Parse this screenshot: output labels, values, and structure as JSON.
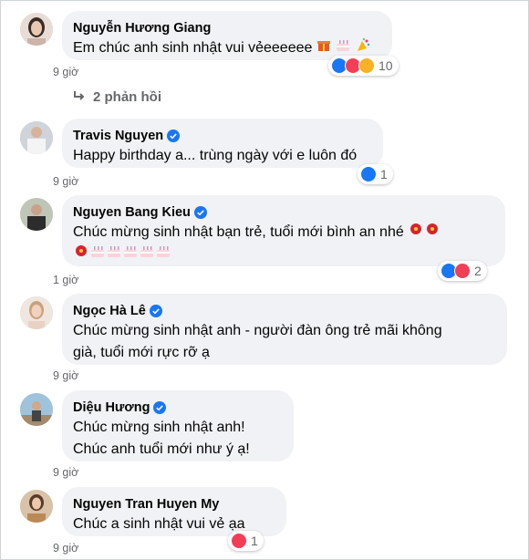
{
  "comments": [
    {
      "author": "Nguyễn Hương Giang",
      "text": "Em chúc anh sinh nhật vui vẻeeeeee",
      "time": "9 giờ",
      "reactions": {
        "icons": [
          "like-icon",
          "love-icon",
          "care-icon"
        ],
        "count": "10"
      },
      "verified": false
    },
    {
      "author": "Travis Nguyen",
      "text": "Happy birthday a... trùng ngày với e luôn đó",
      "time": "9 giờ",
      "reactions": {
        "icons": [
          "like-icon"
        ],
        "count": "1"
      },
      "verified": true
    },
    {
      "author": "Nguyen Bang Kieu",
      "text": "Chúc mừng sinh nhật bạn trẻ, tuổi mới bình an nhé",
      "time": "1 giờ",
      "reactions": {
        "icons": [
          "like-icon",
          "love-icon"
        ],
        "count": "2"
      },
      "verified": true
    },
    {
      "author": "Ngọc Hà Lê",
      "text_line1": "Chúc mừng sinh nhật anh - người đàn ông trẻ mãi không",
      "text_line2": "già, tuổi mới rực rỡ ạ",
      "time": "9 giờ",
      "verified": true
    },
    {
      "author": "Diệu Hương",
      "text_line1": "Chúc mừng sinh nhật anh!",
      "text_line2": "Chúc anh tuổi mới như ý ạ!",
      "time": "9 giờ",
      "verified": true
    },
    {
      "author": "Nguyen Tran Huyen My",
      "text": "Chúc a sinh nhật vui vẻ ạa",
      "time": "9 giờ",
      "reactions": {
        "icons": [
          "love-icon"
        ],
        "count": "1"
      },
      "verified": false
    }
  ],
  "replies_label": "2 phản hồi",
  "colors": {
    "bubble": "#f0f2f5",
    "like": "#1877f2",
    "love": "#f33e58",
    "care": "#f7b125",
    "meta_text": "#65676b"
  }
}
